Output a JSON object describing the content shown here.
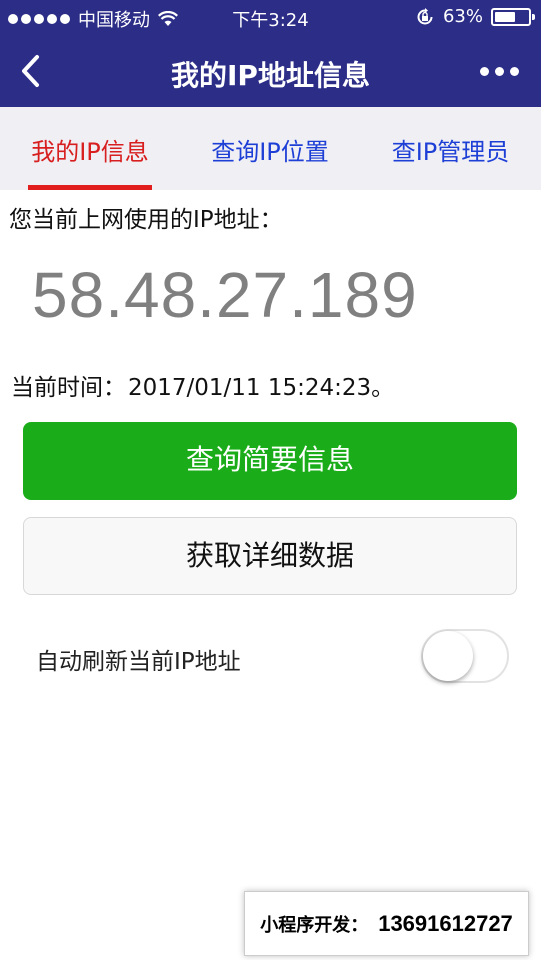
{
  "status_bar": {
    "carrier": "中国移动",
    "time": "下午3:24",
    "battery_percent": "63%",
    "battery_level": 0.63,
    "icons": [
      "signal-dots-icon",
      "wifi-icon",
      "rotation-lock-icon",
      "battery-icon"
    ]
  },
  "nav": {
    "title": "我的IP地址信息",
    "back_icon": "chevron-left-icon",
    "more_icon": "more-dots-icon"
  },
  "tabs": [
    {
      "label": "我的IP信息",
      "active": true
    },
    {
      "label": "查询IP位置",
      "active": false
    },
    {
      "label": "查IP管理员",
      "active": false
    }
  ],
  "main": {
    "ip_label": "您当前上网使用的IP地址：",
    "ip_value": "58.48.27.189",
    "time_label": "当前时间：",
    "time_value": "2017/01/11 15:24:23。",
    "primary_button": "查询简要信息",
    "secondary_button": "获取详细数据",
    "auto_refresh_label": "自动刷新当前IP地址",
    "auto_refresh_on": false
  },
  "promo": {
    "label": "小程序开发：",
    "phone": "13691612727"
  },
  "colors": {
    "header_bg": "#2b2d87",
    "active_tab": "#d81e1e",
    "inactive_tab": "#1e3fd6",
    "primary_button": "#1aad19"
  }
}
